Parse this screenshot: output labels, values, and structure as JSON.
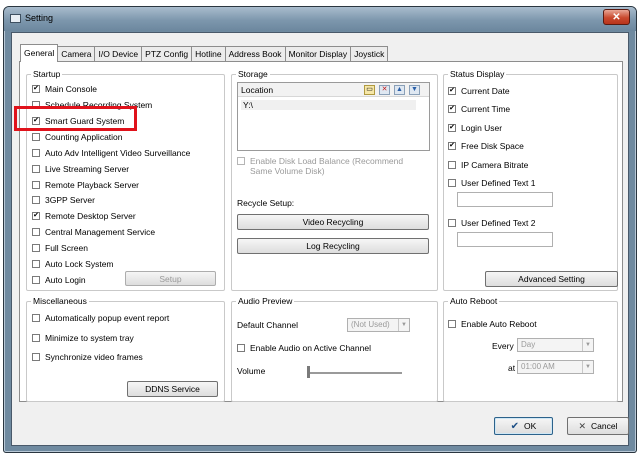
{
  "window": {
    "title": "Setting"
  },
  "tabs": [
    "General",
    "Camera",
    "I/O Device",
    "PTZ Config",
    "Hotline",
    "Address Book",
    "Monitor Display",
    "Joystick"
  ],
  "startup": {
    "title": "Startup",
    "items": [
      {
        "label": "Main Console",
        "checked": true
      },
      {
        "label": "Schedule Recording System",
        "checked": false
      },
      {
        "label": "Smart Guard System",
        "checked": true
      },
      {
        "label": "Counting Application",
        "checked": false
      },
      {
        "label": "Auto Adv Intelligent Video Surveillance",
        "checked": false
      },
      {
        "label": "Live Streaming Server",
        "checked": false
      },
      {
        "label": "Remote Playback Server",
        "checked": false
      },
      {
        "label": "3GPP Server",
        "checked": false
      },
      {
        "label": "Remote Desktop Server",
        "checked": true
      },
      {
        "label": "Central Management Service",
        "checked": false
      },
      {
        "label": "Full Screen",
        "checked": false
      },
      {
        "label": "Auto Lock System",
        "checked": false
      },
      {
        "label": "Auto Login",
        "checked": false
      }
    ],
    "setup_button": "Setup"
  },
  "storage": {
    "title": "Storage",
    "location_header": "Location",
    "location_value": "Y:\\",
    "disk_balance_label": "Enable Disk Load Balance (Recommend Same Volume Disk)",
    "disk_balance_line1": "Enable Disk Load Balance (Recommend",
    "disk_balance_line2": "Same Volume Disk)",
    "recycle_label": "Recycle Setup:",
    "video_recycling": "Video Recycling",
    "log_recycling": "Log Recycling"
  },
  "status_display": {
    "title": "Status Display",
    "items": [
      {
        "label": "Current Date",
        "checked": true
      },
      {
        "label": "Current Time",
        "checked": true
      },
      {
        "label": "Login User",
        "checked": true
      },
      {
        "label": "Free Disk Space",
        "checked": true
      },
      {
        "label": "IP Camera Bitrate",
        "checked": false
      },
      {
        "label": "User Defined Text 1",
        "checked": false
      },
      {
        "label": "User Defined Text 2",
        "checked": false
      }
    ],
    "advanced_button": "Advanced Setting"
  },
  "misc": {
    "title": "Miscellaneous",
    "items": [
      {
        "label": "Automatically popup event report",
        "checked": false
      },
      {
        "label": "Minimize to system tray",
        "checked": false
      },
      {
        "label": "Synchronize video frames",
        "checked": false
      }
    ],
    "ddns_button": "DDNS Service"
  },
  "audio": {
    "title": "Audio Preview",
    "default_channel_label": "Default Channel",
    "default_channel_value": "(Not Used)",
    "enable_audio_label": "Enable Audio on Active Channel",
    "volume_label": "Volume"
  },
  "reboot": {
    "title": "Auto Reboot",
    "enable_label": "Enable Auto Reboot",
    "every_label": "Every",
    "every_value": "Day",
    "at_label": "at",
    "at_value": "01:00 AM"
  },
  "footer": {
    "ok": "OK",
    "cancel": "Cancel"
  },
  "colors": {
    "highlight": "#e0121b",
    "title_bar": "#7d97ad",
    "close_button": "#c9492e"
  },
  "icons": [
    "folder-icon",
    "delete-icon",
    "arrow-up-icon",
    "arrow-down-icon",
    "checkmark-icon",
    "close-icon"
  ]
}
